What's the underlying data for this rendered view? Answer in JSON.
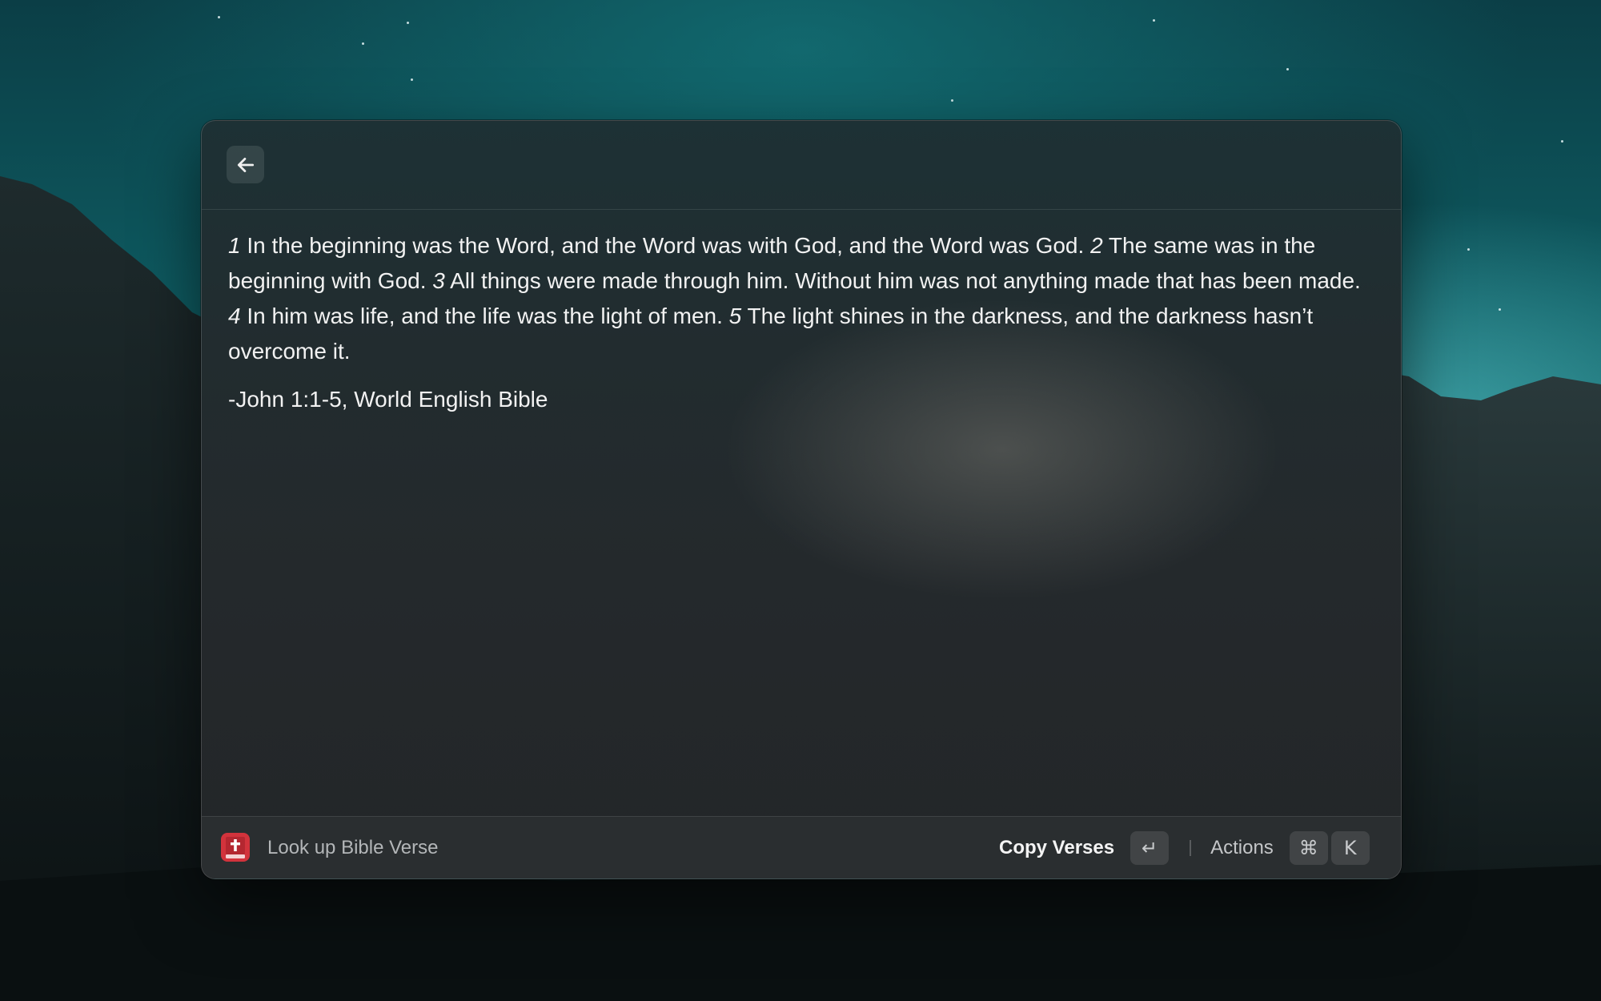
{
  "background": {
    "sky_color": "#0e5a60",
    "mountain_color": "#121b1d"
  },
  "window": {
    "header": {
      "back_icon": "arrow-left-icon"
    },
    "verse_passage": [
      {
        "num": "1",
        "text": " In the beginning was the Word, and the Word was with God, and the Word was God. "
      },
      {
        "num": "2",
        "text": " The same was in the beginning with God. "
      },
      {
        "num": "3",
        "text": " All things were made through him. Without him was not anything made that has been made. "
      },
      {
        "num": "4",
        "text": " In him was life, and the life was the light of men. "
      },
      {
        "num": "5",
        "text": " The light shines in the darkness, and the darkness hasn’t overcome it."
      }
    ],
    "citation": "-John 1:1-5, World English Bible",
    "footer": {
      "extension_icon": "bible-book-icon",
      "extension_icon_color": "#d2333c",
      "extension_title": "Look up Bible Verse",
      "primary_action_label": "Copy Verses",
      "primary_action_key": "↵",
      "actions_label": "Actions",
      "actions_keys": [
        "⌘",
        "K"
      ]
    }
  }
}
